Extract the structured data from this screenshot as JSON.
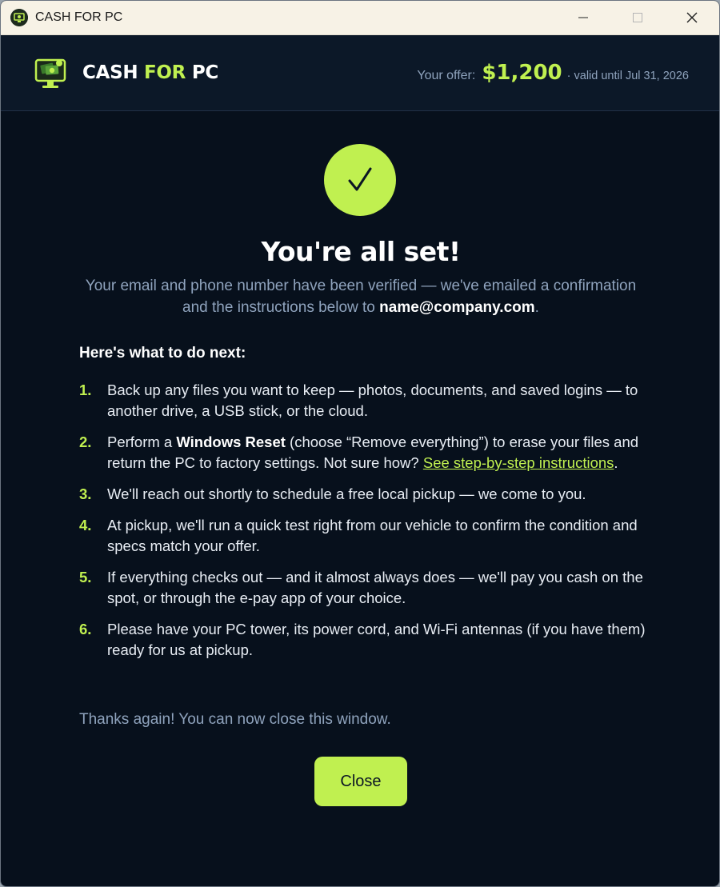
{
  "window": {
    "title": "CASH FOR PC",
    "icon": "cash-for-pc-logo"
  },
  "header": {
    "brand_part1": "CASH",
    "brand_part2": "FOR",
    "brand_part3": "PC",
    "offer_label": "Your offer:",
    "offer_amount": "$1,200",
    "offer_valid": "· valid until Jul 31, 2026"
  },
  "main": {
    "headline": "You're all set!",
    "subtext_before": "Your email and phone number have been verified — we've emailed a confirmation and the instructions below to ",
    "email": "name@company.com",
    "subtext_after": ".",
    "next_heading": "Here's what to do next:",
    "steps": [
      {
        "num": "1.",
        "text": "Back up any files you want to keep — photos, documents, and saved logins — to another drive, a USB stick, or the cloud."
      },
      {
        "num": "2.",
        "pre": "Perform a ",
        "bold": "Windows Reset",
        "mid": " (choose “Remove everything”) to erase your files and return the PC to factory settings. Not sure how? ",
        "link": "See step-by-step instructions",
        "post": "."
      },
      {
        "num": "3.",
        "text": "We'll reach out shortly to schedule a free local pickup — we come to you."
      },
      {
        "num": "4.",
        "text": "At pickup, we'll run a quick test right from our vehicle to confirm the condition and specs match your offer."
      },
      {
        "num": "5.",
        "text": "If everything checks out — and it almost always does — we'll pay you cash on the spot, or through the e-pay app of your choice."
      },
      {
        "num": "6.",
        "text": "Please have your PC tower, its power cord, and Wi-Fi antennas (if you have them) ready for us at pickup."
      }
    ],
    "thanks": "Thanks again! You can now close this window.",
    "close_label": "Close"
  },
  "colors": {
    "accent": "#c0f050",
    "background": "#07101c",
    "header_bg": "#0c1828",
    "muted_text": "#8fa3bd"
  }
}
